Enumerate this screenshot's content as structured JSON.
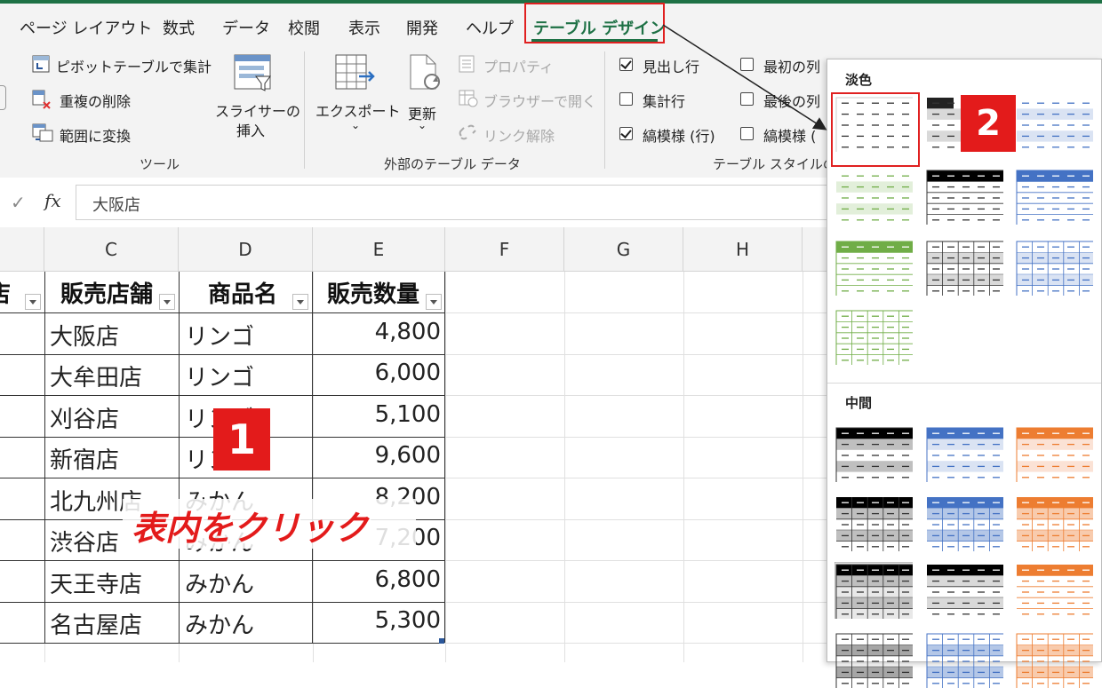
{
  "tabs": [
    "ページ レイアウト",
    "数式",
    "データ",
    "校閲",
    "表示",
    "開発",
    "ヘルプ",
    "テーブル デザイン"
  ],
  "ribbon": {
    "tools": {
      "pivot": "ピボットテーブルで集計",
      "remove_dup": "重複の削除",
      "convert_range": "範囲に変換",
      "slicer": [
        "スライサーの",
        "挿入"
      ],
      "label": "ツール"
    },
    "external": {
      "export": "エクスポート",
      "refresh": "更新",
      "properties": "プロパティ",
      "open_browser": "ブラウザーで開く",
      "unlink": "リンク解除",
      "label": "外部のテーブル データ"
    },
    "style_options": {
      "header_row": "見出し行",
      "total_row": "集計行",
      "banded_rows": "縞模様 (行)",
      "first_col": "最初の列",
      "last_col": "最後の列",
      "banded_cols": "縞模様 (",
      "label": "テーブル スタイルの"
    }
  },
  "formula_bar": {
    "fx": "fx",
    "value": "大阪店"
  },
  "columns": [
    "C",
    "D",
    "E",
    "F",
    "G",
    "H"
  ],
  "table": {
    "headers": [
      "販売店舗",
      "商品名",
      "販売数量"
    ],
    "rows": [
      [
        "大阪店",
        "リンゴ",
        "4,800"
      ],
      [
        "大牟田店",
        "リンゴ",
        "6,000"
      ],
      [
        "刈谷店",
        "リンゴ",
        "5,100"
      ],
      [
        "新宿店",
        "リンゴ",
        "9,600"
      ],
      [
        "北九州店",
        "みかん",
        "8,200"
      ],
      [
        "渋谷店",
        "みかん",
        "7,200"
      ],
      [
        "天王寺店",
        "みかん",
        "6,800"
      ],
      [
        "名古屋店",
        "みかん",
        "5,300"
      ]
    ]
  },
  "panel": {
    "light": "淡色",
    "medium": "中間"
  },
  "annotations": {
    "badge1": "1",
    "badge2": "2",
    "callout": "表内をクリック"
  },
  "colors": {
    "accent_green": "#1e7145",
    "red": "#e31b1b",
    "blue": "#4472c4",
    "green": "#70ad47",
    "orange": "#ed7d31"
  }
}
